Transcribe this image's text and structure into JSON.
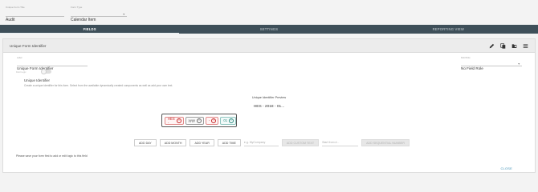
{
  "top": {
    "name_label": "Unique Form Title",
    "name_value": "Audit",
    "type_label": "Form Type",
    "type_value": "Calendar Item"
  },
  "tabs": [
    {
      "label": "FIELDS",
      "active": true
    },
    {
      "label": "SETTINGS",
      "active": false
    },
    {
      "label": "REPORTING VIEW",
      "active": false
    }
  ],
  "card": {
    "title": "Unique Form Identifier",
    "icons": [
      "pencil-icon",
      "copy-icon",
      "folder-icon",
      "menu-icon"
    ],
    "field_label": "Label",
    "field_value": "Unique Form Identifier",
    "role_label": "Field Role",
    "role_value": "No Field Role",
    "toggle_label": "Field Logic",
    "uid_title": "Unique Identifier",
    "uid_desc": "Create a unique identifier for this form. Select from the available dynamically created components as well as add your own text.",
    "preview_label": "Unique Identifier Preview",
    "preview_value": "HES - 2018 - 01...",
    "chips": [
      {
        "label": "HES -",
        "style": "red"
      },
      {
        "label": "yyyy",
        "style": "gray"
      },
      {
        "label": "-",
        "style": "red"
      },
      {
        "label": "01",
        "style": "teal"
      }
    ],
    "buttons": {
      "add_day": "ADD DAY",
      "add_month": "ADD MONTH",
      "add_year": "ADD YEAR",
      "add_time": "ADD TIME",
      "custom_placeholder": "e.g. MyCompany",
      "add_custom": "ADD CUSTOM TEXT",
      "start_placeholder": "Start from #...",
      "add_sequential": "ADD SEQUENTIAL NUMBER"
    },
    "save_note": "Please save your form first to add or edit logic to this field",
    "close_label": "CLOSE"
  },
  "colors": {
    "tabbar": "#3e4f59",
    "accent_link": "#3b8fb5",
    "chip_red": "#c62828",
    "chip_teal": "#2e8b82"
  }
}
